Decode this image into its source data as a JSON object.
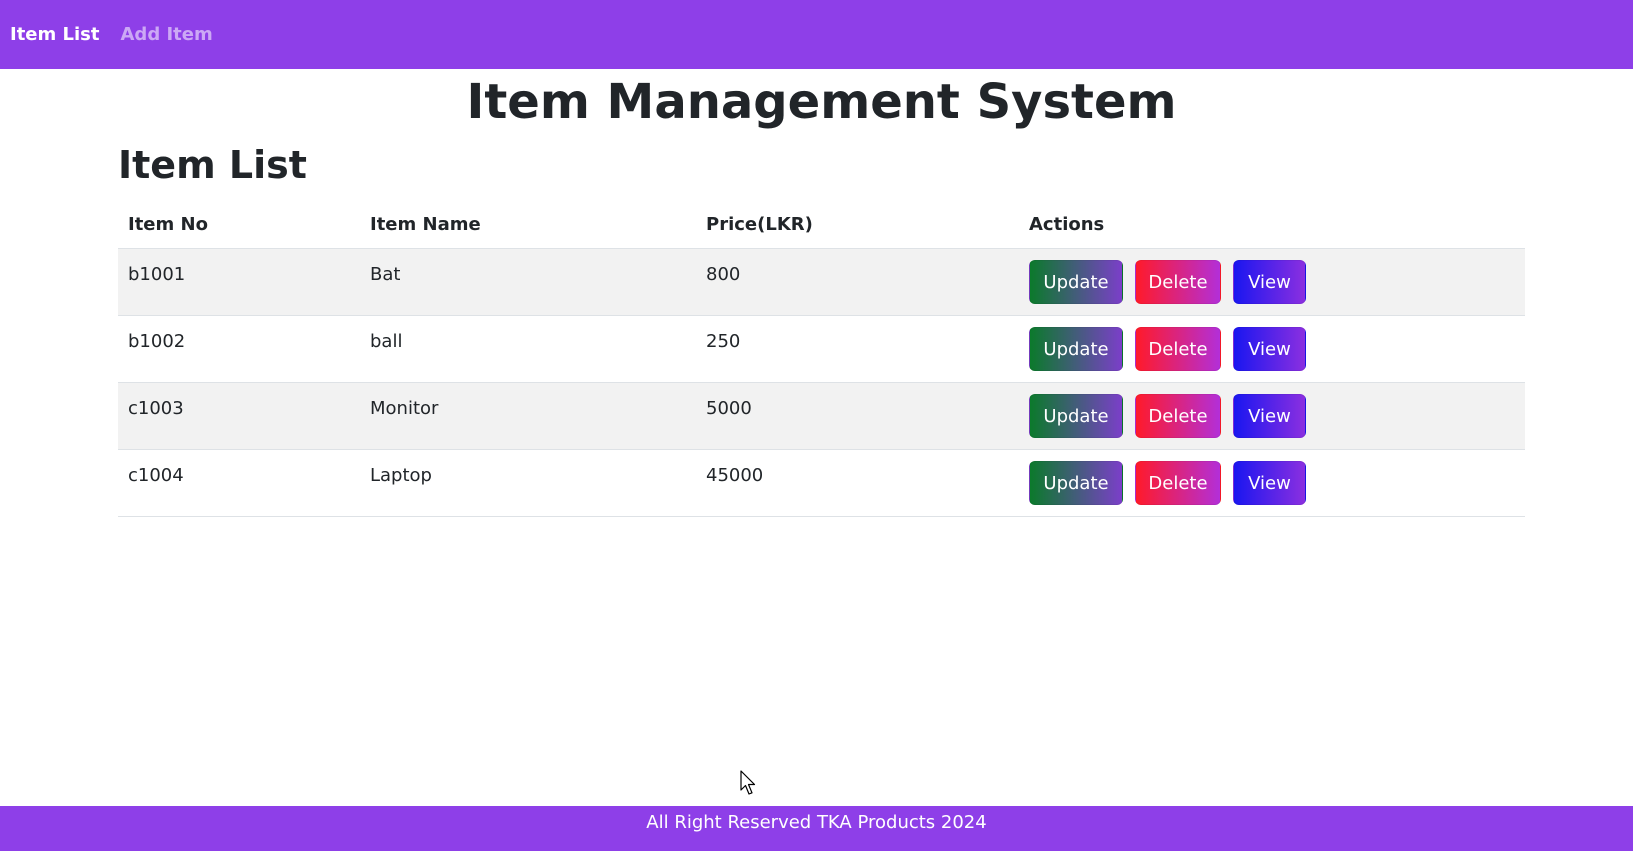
{
  "nav": {
    "items": [
      {
        "label": "Item List",
        "active": true
      },
      {
        "label": "Add Item",
        "active": false
      }
    ]
  },
  "page_title": "Item Management System",
  "section_title": "Item List",
  "table": {
    "headers": [
      "Item No",
      "Item Name",
      "Price(LKR)",
      "Actions"
    ],
    "rows": [
      {
        "no": "b1001",
        "name": "Bat",
        "price": "800"
      },
      {
        "no": "b1002",
        "name": "ball",
        "price": "250"
      },
      {
        "no": "c1003",
        "name": "Monitor",
        "price": "5000"
      },
      {
        "no": "c1004",
        "name": "Laptop",
        "price": "45000"
      }
    ],
    "actions": {
      "update": "Update",
      "delete": "Delete",
      "view": "View"
    }
  },
  "footer": {
    "text": "All Right Reserved TKA Products 2024"
  },
  "colors": {
    "navbar": "#8e3fe8",
    "footer": "#8e3fe8"
  }
}
